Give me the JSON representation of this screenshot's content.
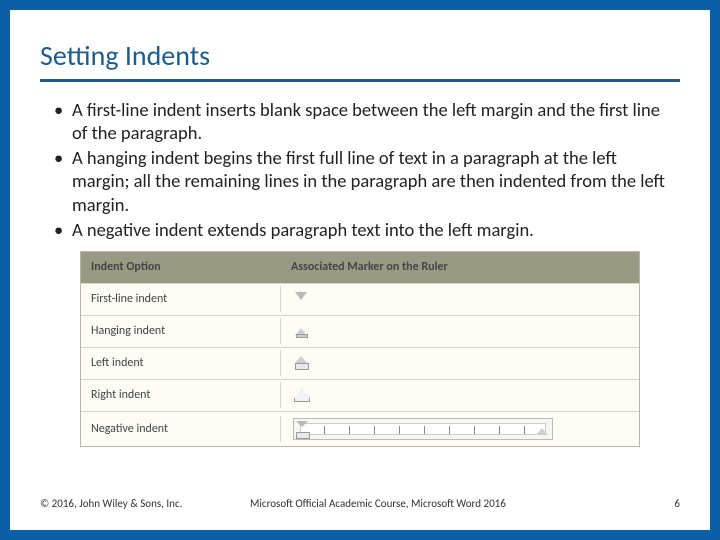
{
  "title": "Setting Indents",
  "bullets": [
    "A first-line indent inserts blank space between the left margin and the first line of the paragraph.",
    "A hanging indent begins the first full line of text in a paragraph at the left margin; all the remaining lines in the paragraph are then indented from the left margin.",
    "A negative indent extends paragraph text into the left margin."
  ],
  "table": {
    "headers": [
      "Indent Option",
      "Associated Marker on the Ruler"
    ],
    "rows": [
      {
        "label": "First-line indent",
        "marker": "firstline"
      },
      {
        "label": "Hanging indent",
        "marker": "hanging"
      },
      {
        "label": "Left indent",
        "marker": "left"
      },
      {
        "label": "Right indent",
        "marker": "right"
      },
      {
        "label": "Negative indent",
        "marker": "ruler"
      }
    ]
  },
  "footer": {
    "copyright": "© 2016, John Wiley & Sons, Inc.",
    "course": "Microsoft Official Academic Course, Microsoft Word 2016",
    "page": "6"
  }
}
